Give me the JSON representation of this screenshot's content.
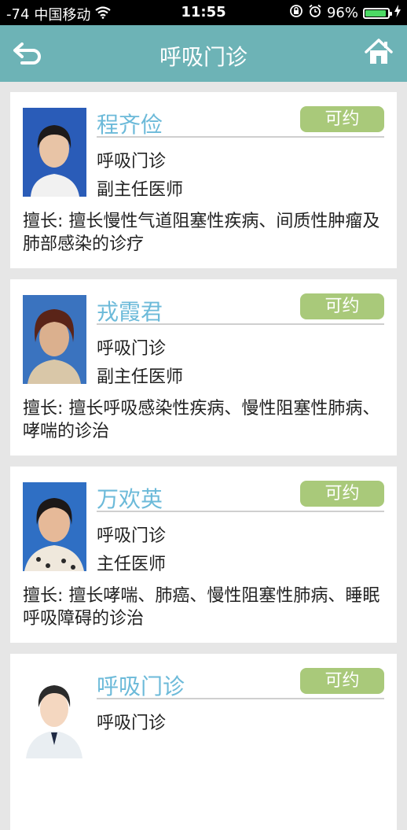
{
  "status_bar": {
    "signal": "-74",
    "carrier": "中国移动",
    "time": "11:55",
    "battery": "96%",
    "battery_level": 0.96
  },
  "nav": {
    "title": "呼吸门诊",
    "back_icon": "back-arrow-icon",
    "home_icon": "home-icon"
  },
  "colors": {
    "nav_bg": "#6db3b6",
    "name": "#6cbad9",
    "book_button": "#a9c97a"
  },
  "doctors": [
    {
      "name": "程齐俭",
      "book_label": "可约",
      "department": "呼吸门诊",
      "title": "副主任医师",
      "specialty": "擅长: 擅长慢性气道阻塞性疾病、间质性肿瘤及肺部感染的诊疗"
    },
    {
      "name": "戎霞君",
      "book_label": "可约",
      "department": "呼吸门诊",
      "title": "副主任医师",
      "specialty": "擅长: 擅长呼吸感染性疾病、慢性阻塞性肺病、哮喘的诊治"
    },
    {
      "name": "万欢英",
      "book_label": "可约",
      "department": "呼吸门诊",
      "title": "主任医师",
      "specialty": "擅长: 擅长哮喘、肺癌、慢性阻塞性肺病、睡眠呼吸障碍的诊治"
    },
    {
      "name": "呼吸门诊",
      "book_label": "可约",
      "department": "呼吸门诊",
      "title": "",
      "specialty": ""
    }
  ]
}
